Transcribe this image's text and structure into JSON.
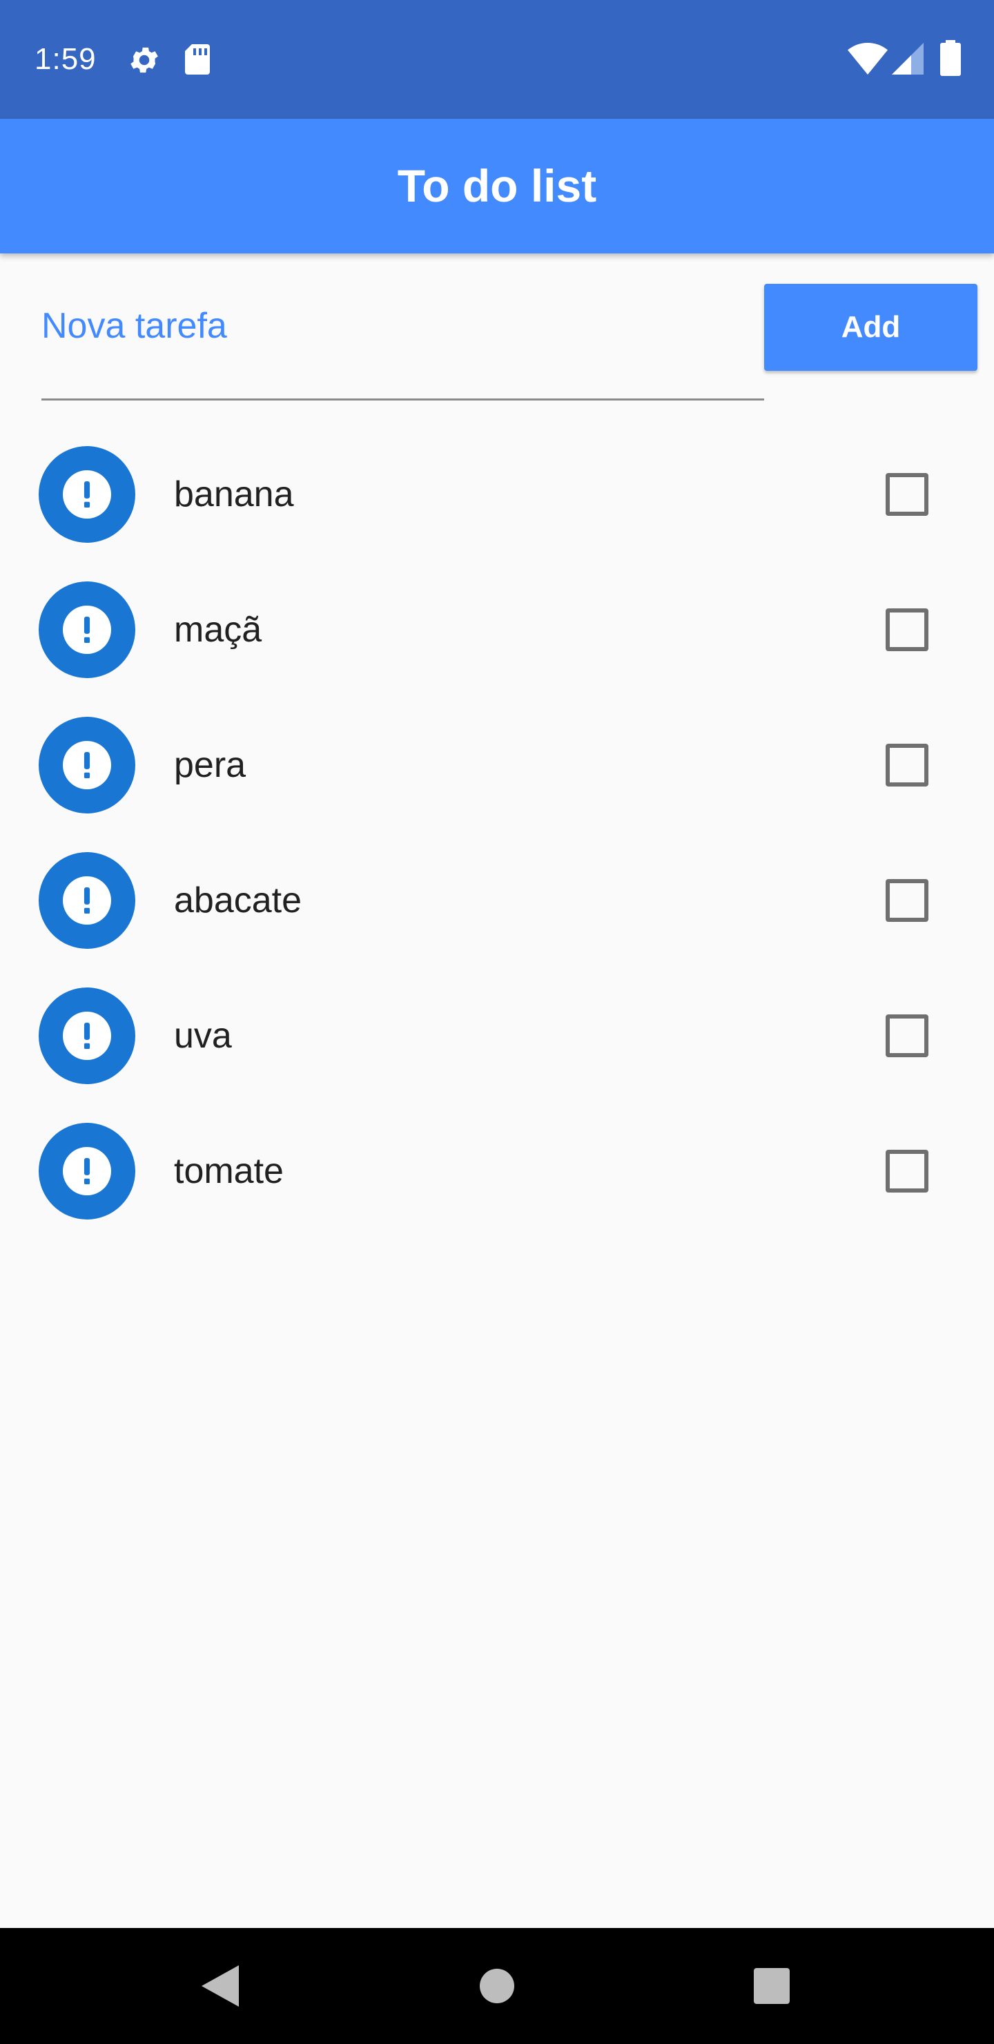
{
  "status_bar": {
    "time": "1:59",
    "icons": [
      "gear-icon",
      "sd-card-icon",
      "wifi-icon",
      "signal-icon",
      "battery-icon"
    ]
  },
  "app_bar": {
    "title": "To do list",
    "color": "#448aff"
  },
  "new_task": {
    "placeholder": "Nova tarefa",
    "value": "",
    "button_label": "Add"
  },
  "tasks": [
    {
      "label": "banana",
      "icon": "exclamation-icon",
      "checked": false
    },
    {
      "label": "maçã",
      "icon": "exclamation-icon",
      "checked": false
    },
    {
      "label": "pera",
      "icon": "exclamation-icon",
      "checked": false
    },
    {
      "label": "abacate",
      "icon": "exclamation-icon",
      "checked": false
    },
    {
      "label": "uva",
      "icon": "exclamation-icon",
      "checked": false
    },
    {
      "label": "tomate",
      "icon": "exclamation-icon",
      "checked": false
    }
  ],
  "nav_bar": {
    "buttons": [
      "back-icon",
      "home-icon",
      "recents-icon"
    ]
  },
  "colors": {
    "status_bar": "#3567c2",
    "accent": "#448aff",
    "avatar": "#1976d2",
    "background": "#fafafa"
  }
}
